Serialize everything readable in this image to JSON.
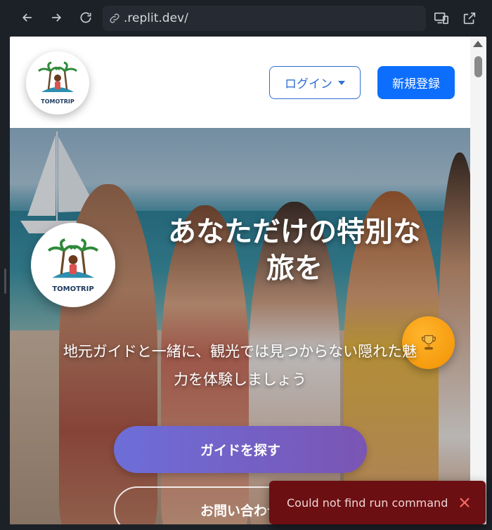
{
  "browser": {
    "url": ".replit.dev/"
  },
  "header": {
    "logo_text": "TOMOTRIP",
    "brand_name": "TomoTrip",
    "login_label": "ログイン",
    "signup_label": "新規登録"
  },
  "hero": {
    "logo_text": "TOMOTRIP",
    "title_line1": "あなただけの特別な",
    "title_line2": "旅を",
    "subtitle_line1": "地元ガイドと一緒に、観光では見つからない隠れた魅",
    "subtitle_line2": "力を体験しましょう",
    "primary_button": "ガイドを探す",
    "secondary_button": "お問い合わせ"
  },
  "toast": {
    "message": "Could not find run command"
  },
  "colors": {
    "primary": "#0d6efd",
    "toast_bg": "#6b0f12",
    "trophy": "#f29100",
    "cta_gradient_start": "#6d6ed8",
    "cta_gradient_end": "#7a55b4"
  }
}
